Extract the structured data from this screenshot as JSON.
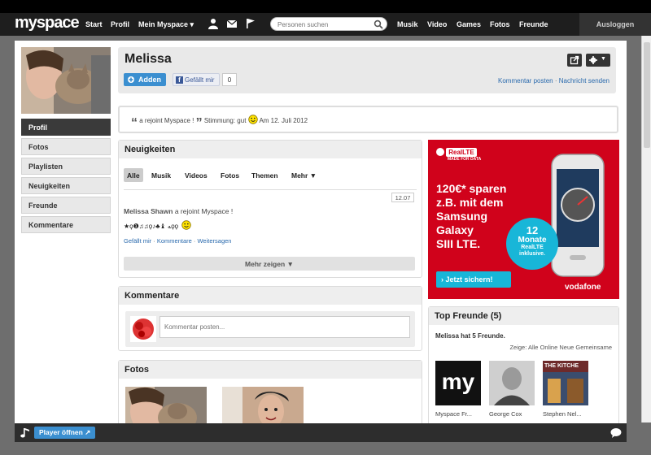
{
  "topbar": {
    "logo": "myspace",
    "nav": [
      "Start",
      "Profil",
      "Mein Myspace"
    ],
    "media_nav": [
      "Musik",
      "Video",
      "Games",
      "Fotos",
      "Freunde"
    ],
    "search_placeholder": "Personen suchen",
    "logout": "Ausloggen",
    "dropdown_arrow": "▾"
  },
  "profile": {
    "name": "Melissa",
    "add_label": "Adden",
    "like_label": "Gefällt mir",
    "like_count": "0",
    "links": [
      "Kommentar posten",
      "Nachricht senden"
    ],
    "link_sep": "·",
    "settings_arrow": "▼"
  },
  "sidebar": {
    "items": [
      "Profil",
      "Fotos",
      "Playlisten",
      "Neuigkeiten",
      "Freunde",
      "Kommentare"
    ]
  },
  "mood": {
    "status": "a rejoint Myspace !",
    "mood_label": "Stimmung: gut",
    "date": "Am 12. Juli 2012"
  },
  "news": {
    "title": "Neuigkeiten",
    "tabs": [
      "Alle",
      "Musik",
      "Videos",
      "Fotos",
      "Themen",
      "Mehr ▼"
    ],
    "date": "12.07",
    "author": "Melissa Shawn",
    "text": "a rejoint Myspace !",
    "glyphs": "★ϙ❶♫♫ϙ♪♣♝ ﻪϙϙ",
    "actions": [
      "Gefällt mir",
      "Kommentare",
      "Weitersagen"
    ],
    "action_sep": "·",
    "more": "Mehr zeigen ▼"
  },
  "comments": {
    "title": "Kommentare",
    "placeholder": "Kommentar posten..."
  },
  "photos": {
    "title": "Fotos"
  },
  "ad": {
    "badge": "RealLTE",
    "badge_sub": "MADE FOR DATA",
    "headline": [
      "120€* sparen",
      "z.B. mit dem",
      "Samsung",
      "Galaxy",
      "SIII LTE."
    ],
    "circle": [
      "12",
      "Monate",
      "RealLTE",
      "inklusive."
    ],
    "cta": "Jetzt sichern!",
    "brand": "vodafone"
  },
  "friends": {
    "title": "Top Freunde (5)",
    "subtitle": "Melissa hat 5 Freunde.",
    "filter_label": "Zeige:",
    "filters": [
      "Alle",
      "Online",
      "Neue",
      "Gemeinsame"
    ],
    "items": [
      {
        "name": "Myspace Fr...",
        "logo": "my"
      },
      {
        "name": "George Cox"
      },
      {
        "name": "Stephen Nel...",
        "sign": "THE KITCHE"
      }
    ]
  },
  "player": {
    "label": "Player öffnen ↗"
  },
  "colors": {
    "accent": "#3b8fd0",
    "ad_red": "#d0021b",
    "ad_cyan": "#18b6d8",
    "link": "#2a6aad"
  }
}
